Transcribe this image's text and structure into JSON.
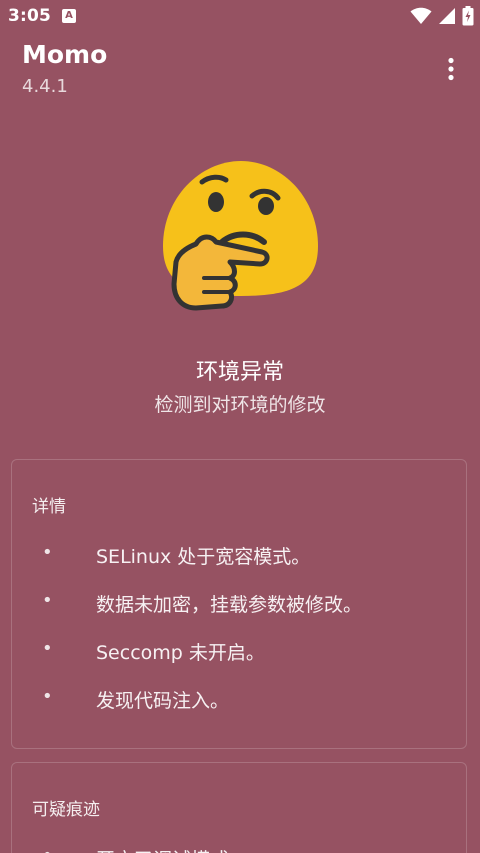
{
  "status_bar": {
    "time": "3:05",
    "notification_glyph": "A",
    "icons": [
      "wifi-icon",
      "signal-icon",
      "battery-charging-icon"
    ]
  },
  "app_bar": {
    "title": "Momo",
    "version": "4.4.1",
    "menu_icon": "more-vert-icon"
  },
  "result": {
    "emoji": "thinking-face-icon",
    "title": "环境异常",
    "subtitle": "检测到对环境的修改"
  },
  "details_card": {
    "header": "详情",
    "bullet": "•",
    "items": [
      "SELinux 处于宽容模式。",
      "数据未加密，挂载参数被修改。",
      "Seccomp 未开启。",
      "发现代码注入。"
    ]
  },
  "traces_card": {
    "header": "可疑痕迹",
    "bullet": "•",
    "first_item": "开启了调试模式"
  },
  "colors": {
    "background": "#965262",
    "emoji_face": "#F6C11A",
    "emoji_hand": "#F3B73A",
    "emoji_outline": "#333333"
  }
}
